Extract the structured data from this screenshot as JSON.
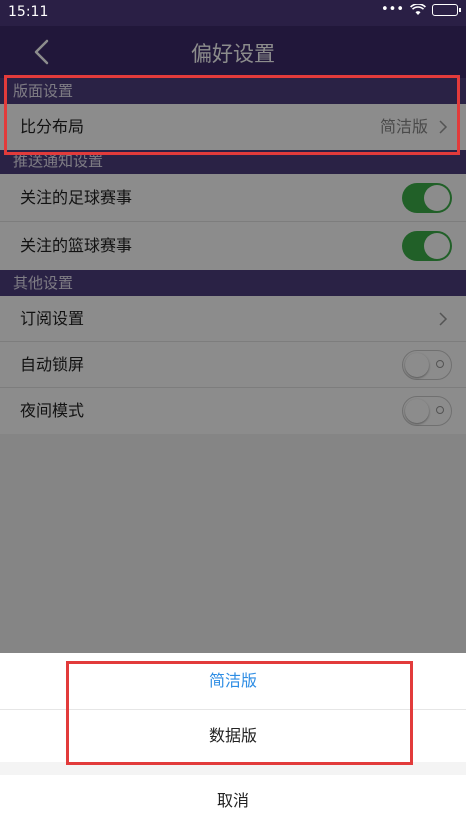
{
  "status_bar": {
    "time": "15:11",
    "dots": "•••"
  },
  "nav": {
    "title": "偏好设置"
  },
  "sections": {
    "layout": {
      "header": "版面设置",
      "rows": [
        {
          "label": "比分布局",
          "value": "简洁版"
        }
      ]
    },
    "push": {
      "header": "推送通知设置",
      "rows": [
        {
          "label": "关注的足球赛事",
          "toggle": "on"
        },
        {
          "label": "关注的篮球赛事",
          "toggle": "on"
        }
      ]
    },
    "other": {
      "header": "其他设置",
      "rows": [
        {
          "label": "订阅设置"
        },
        {
          "label": "自动锁屏",
          "toggle": "off"
        },
        {
          "label": "夜间模式",
          "toggle": "off"
        }
      ]
    }
  },
  "sheet": {
    "options": [
      "简洁版",
      "数据版"
    ],
    "cancel": "取消"
  },
  "colors": {
    "nav_bg": "#3d2a6b",
    "section_bg": "#4e3e7f",
    "toggle_on": "#3cb04a",
    "accent_blue": "#2e8de4",
    "highlight_red": "#e23b3b"
  }
}
